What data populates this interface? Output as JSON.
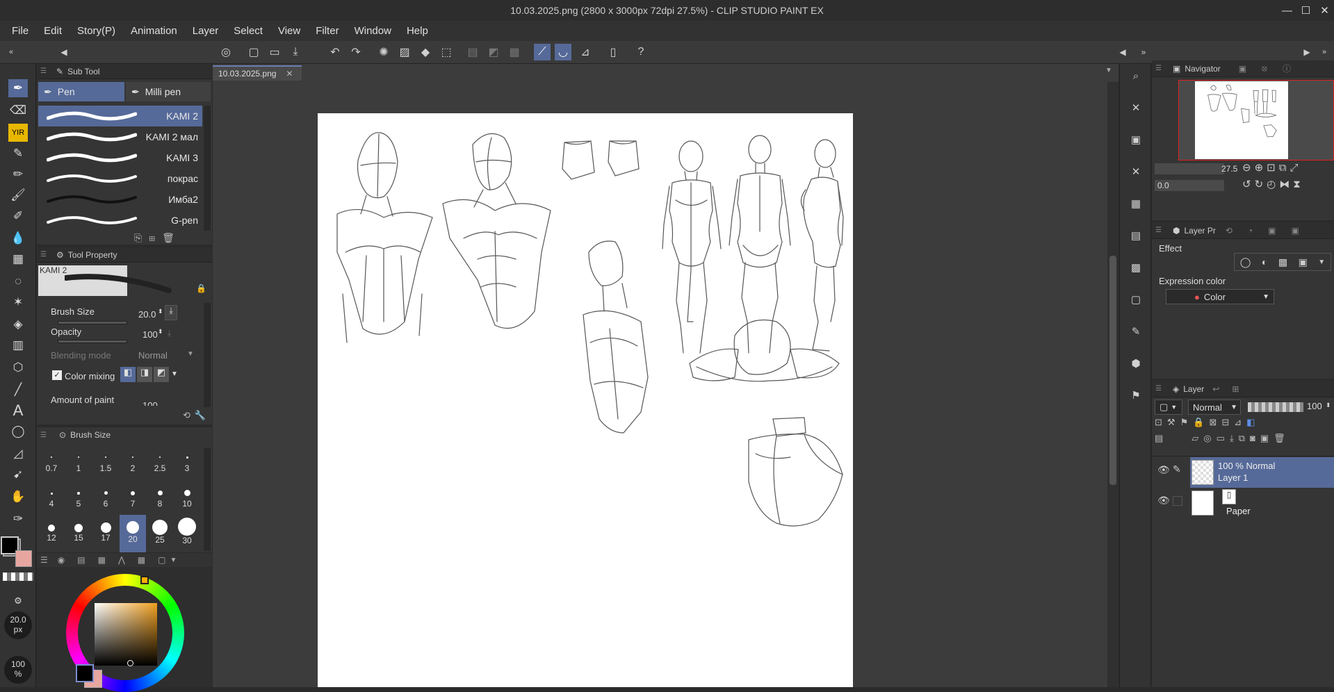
{
  "window": {
    "title": "10.03.2025.png (2800 x 3000px 72dpi 27.5%)  - CLIP STUDIO PAINT EX",
    "minimize": "—",
    "maximize": "☐",
    "close": "✕"
  },
  "menu": [
    "File",
    "Edit",
    "Story(P)",
    "Animation",
    "Layer",
    "Select",
    "View",
    "Filter",
    "Window",
    "Help"
  ],
  "subtool": {
    "header": "Sub Tool",
    "tabs": [
      "Pen",
      "Milli pen"
    ],
    "brushes": [
      "KAMI 2",
      "KAMI 2 мал",
      "KAMI 3",
      "покрас",
      "Имба2",
      "G-pen"
    ],
    "selected": "KAMI 2"
  },
  "toolprop": {
    "header": "Tool Property",
    "preview_name": "KAMI 2",
    "brush_size_label": "Brush Size",
    "brush_size": "20.0",
    "opacity_label": "Opacity",
    "opacity": "100",
    "blending_label": "Blending mode",
    "blending": "Normal",
    "color_mixing_label": "Color mixing",
    "color_mixing": true,
    "amount_label": "Amount of paint",
    "amount": "100"
  },
  "brushsize": {
    "header": "Brush Size",
    "sizes": [
      "0.7",
      "1",
      "1.5",
      "2",
      "2.5",
      "3",
      "4",
      "5",
      "6",
      "7",
      "8",
      "10",
      "12",
      "15",
      "17",
      "20",
      "25",
      "30"
    ],
    "selected": "20"
  },
  "left_status": {
    "size": "20.0",
    "unit": "px",
    "opacity": "100",
    "opacity_unit": "%"
  },
  "document": {
    "tab": "10.03.2025.png"
  },
  "navigator": {
    "header": "Navigator",
    "zoom": "27.5",
    "rotation": "0.0"
  },
  "layerprop": {
    "header": "Layer Pr",
    "effect_label": "Effect",
    "expression_label": "Expression color",
    "expression_value": "Color"
  },
  "layer": {
    "header": "Layer",
    "blend": "Normal",
    "opacity": "100",
    "layers": [
      {
        "line1": "100 % Normal",
        "line2": "Layer 1"
      },
      {
        "line1": "",
        "line2": "Paper"
      }
    ]
  },
  "colors": {
    "accent": "#566a99",
    "main_color": "#000000",
    "sub_color": "#e8a6a0"
  }
}
